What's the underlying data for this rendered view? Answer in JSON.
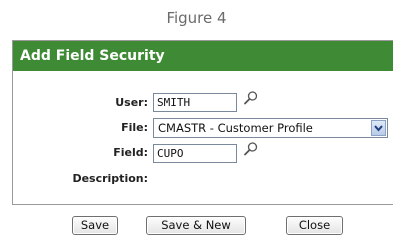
{
  "caption": "Figure 4",
  "dialog": {
    "title": "Add Field Security",
    "fields": {
      "user_label": "User:",
      "user_value": "SMITH",
      "file_label": "File:",
      "file_value": "CMASTR - Customer Profile",
      "field_label": "Field:",
      "field_value": "CUPO",
      "description_label": "Description:"
    },
    "buttons": {
      "save": "Save",
      "save_new": "Save & New",
      "close": "Close"
    }
  },
  "colors": {
    "titlebar": "#3e8a35"
  },
  "icons": {
    "lookup": "magnifier-icon",
    "dropdown": "chevron-down-icon"
  }
}
